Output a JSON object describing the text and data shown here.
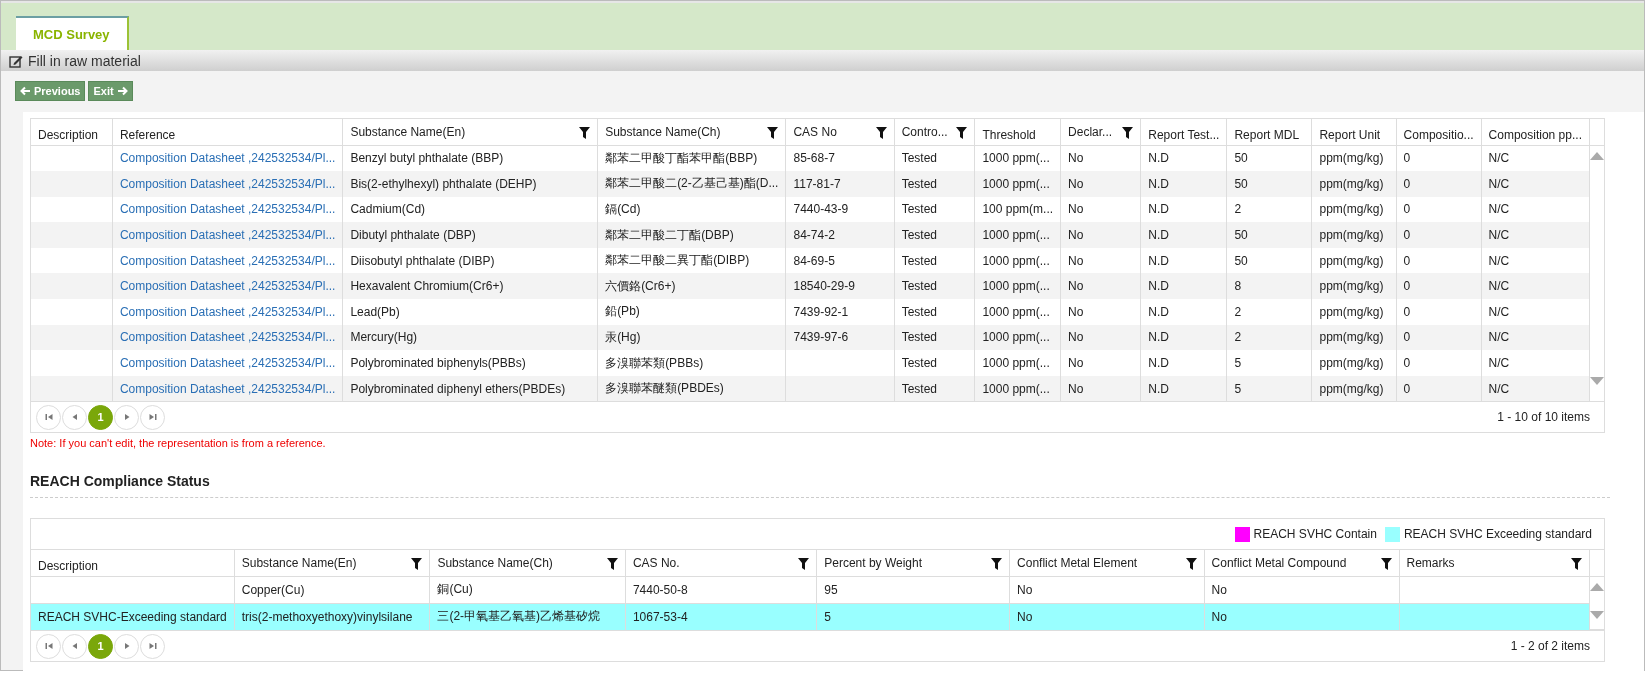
{
  "tabs": [
    {
      "label": "MCD Survey",
      "selected": true
    }
  ],
  "toolbar": {
    "title": "Fill in raw material"
  },
  "buttons": [
    {
      "label": "Previous",
      "kind": "back"
    },
    {
      "label": "Exit",
      "kind": "forward"
    }
  ],
  "materials_table": {
    "columns": [
      {
        "label": "Description",
        "filter": false
      },
      {
        "label": "Reference",
        "filter": false,
        "kind": "link"
      },
      {
        "label": "Substance Name(En)",
        "filter": true,
        "kind": "text"
      },
      {
        "label": "Substance Name(Ch)",
        "filter": true,
        "kind": "text"
      },
      {
        "label": "CAS No",
        "filter": true,
        "kind": "text"
      },
      {
        "label": "Contro...",
        "filter": true,
        "kind": "text"
      },
      {
        "label": "Threshold",
        "filter": false,
        "kind": "text"
      },
      {
        "label": "Declar...",
        "filter": true,
        "kind": "text"
      },
      {
        "label": "Report Test...",
        "filter": false,
        "kind": "text"
      },
      {
        "label": "Report MDL",
        "filter": false,
        "kind": "text"
      },
      {
        "label": "Report Unit",
        "filter": false,
        "kind": "text"
      },
      {
        "label": "Compositio...",
        "filter": false,
        "kind": "text"
      },
      {
        "label": "Composition pp...",
        "filter": false,
        "kind": "text"
      }
    ],
    "rows": [
      [
        "",
        "Composition Datasheet ,242532534/Pl...",
        "Benzyl butyl phthalate (BBP)",
        "鄰苯二甲酸丁酯苯甲酯(BBP)",
        "85-68-7",
        "Tested",
        "1000 ppm(...",
        "No",
        "N.D",
        "50",
        "ppm(mg/kg)",
        "0",
        "N/C"
      ],
      [
        "",
        "Composition Datasheet ,242532534/Pl...",
        "Bis(2-ethylhexyl) phthalate (DEHP)",
        "鄰苯二甲酸二(2-乙基己基)酯(D...",
        "117-81-7",
        "Tested",
        "1000 ppm(...",
        "No",
        "N.D",
        "50",
        "ppm(mg/kg)",
        "0",
        "N/C"
      ],
      [
        "",
        "Composition Datasheet ,242532534/Pl...",
        "Cadmium(Cd)",
        "鎘(Cd)",
        "7440-43-9",
        "Tested",
        "100 ppm(m...",
        "No",
        "N.D",
        "2",
        "ppm(mg/kg)",
        "0",
        "N/C"
      ],
      [
        "",
        "Composition Datasheet ,242532534/Pl...",
        "Dibutyl phthalate (DBP)",
        "鄰苯二甲酸二丁酯(DBP)",
        "84-74-2",
        "Tested",
        "1000 ppm(...",
        "No",
        "N.D",
        "50",
        "ppm(mg/kg)",
        "0",
        "N/C"
      ],
      [
        "",
        "Composition Datasheet ,242532534/Pl...",
        "Diisobutyl phthalate (DIBP)",
        "鄰苯二甲酸二異丁酯(DIBP)",
        "84-69-5",
        "Tested",
        "1000 ppm(...",
        "No",
        "N.D",
        "50",
        "ppm(mg/kg)",
        "0",
        "N/C"
      ],
      [
        "",
        "Composition Datasheet ,242532534/Pl...",
        "Hexavalent Chromium(Cr6+)",
        "六價鉻(Cr6+)",
        "18540-29-9",
        "Tested",
        "1000 ppm(...",
        "No",
        "N.D",
        "8",
        "ppm(mg/kg)",
        "0",
        "N/C"
      ],
      [
        "",
        "Composition Datasheet ,242532534/Pl...",
        "Lead(Pb)",
        "鉛(Pb)",
        "7439-92-1",
        "Tested",
        "1000 ppm(...",
        "No",
        "N.D",
        "2",
        "ppm(mg/kg)",
        "0",
        "N/C"
      ],
      [
        "",
        "Composition Datasheet ,242532534/Pl...",
        "Mercury(Hg)",
        "汞(Hg)",
        "7439-97-6",
        "Tested",
        "1000 ppm(...",
        "No",
        "N.D",
        "2",
        "ppm(mg/kg)",
        "0",
        "N/C"
      ],
      [
        "",
        "Composition Datasheet ,242532534/Pl...",
        "Polybrominated biphenyls(PBBs)",
        "多溴聯苯類(PBBs)",
        "",
        "Tested",
        "1000 ppm(...",
        "No",
        "N.D",
        "5",
        "ppm(mg/kg)",
        "0",
        "N/C"
      ],
      [
        "",
        "Composition Datasheet ,242532534/Pl...",
        "Polybrominated diphenyl ethers(PBDEs)",
        "多溴聯苯醚類(PBDEs)",
        "",
        "Tested",
        "1000 ppm(...",
        "No",
        "N.D",
        "5",
        "ppm(mg/kg)",
        "0",
        "N/C"
      ]
    ],
    "pager": {
      "pages": [
        {
          "label": "1",
          "selected": true
        }
      ],
      "info": "1 - 10 of 10 items"
    }
  },
  "note": "Note: If you can't edit, the representation is from a reference.",
  "reach_section": {
    "title": "REACH Compliance Status",
    "legend": [
      {
        "label": "REACH SVHC Contain",
        "color": "#ff00ff"
      },
      {
        "label": "REACH SVHC Exceeding standard",
        "color": "#99ffff"
      }
    ],
    "columns": [
      {
        "label": "Description",
        "filter": false
      },
      {
        "label": "Substance Name(En)",
        "filter": true
      },
      {
        "label": "Substance Name(Ch)",
        "filter": true
      },
      {
        "label": "CAS No.",
        "filter": true
      },
      {
        "label": "Percent by Weight",
        "filter": true
      },
      {
        "label": "Conflict Metal Element",
        "filter": true
      },
      {
        "label": "Conflict Metal Compound",
        "filter": true
      },
      {
        "label": "Remarks",
        "filter": true
      }
    ],
    "rows": [
      {
        "cells": [
          "",
          "Copper(Cu)",
          "銅(Cu)",
          "7440-50-8",
          "95",
          "No",
          "No",
          ""
        ]
      },
      {
        "cells": [
          "REACH SVHC-Exceeding standard",
          "tris(2-methoxyethoxy)vinylsilane",
          "三(2-甲氧基乙氧基)乙烯基矽烷",
          "1067-53-4",
          "5",
          "No",
          "No",
          ""
        ],
        "color": "#99ffff"
      }
    ],
    "pager": {
      "pages": [
        {
          "label": "1",
          "selected": true
        }
      ],
      "info": "1 - 2 of 2 items"
    }
  }
}
